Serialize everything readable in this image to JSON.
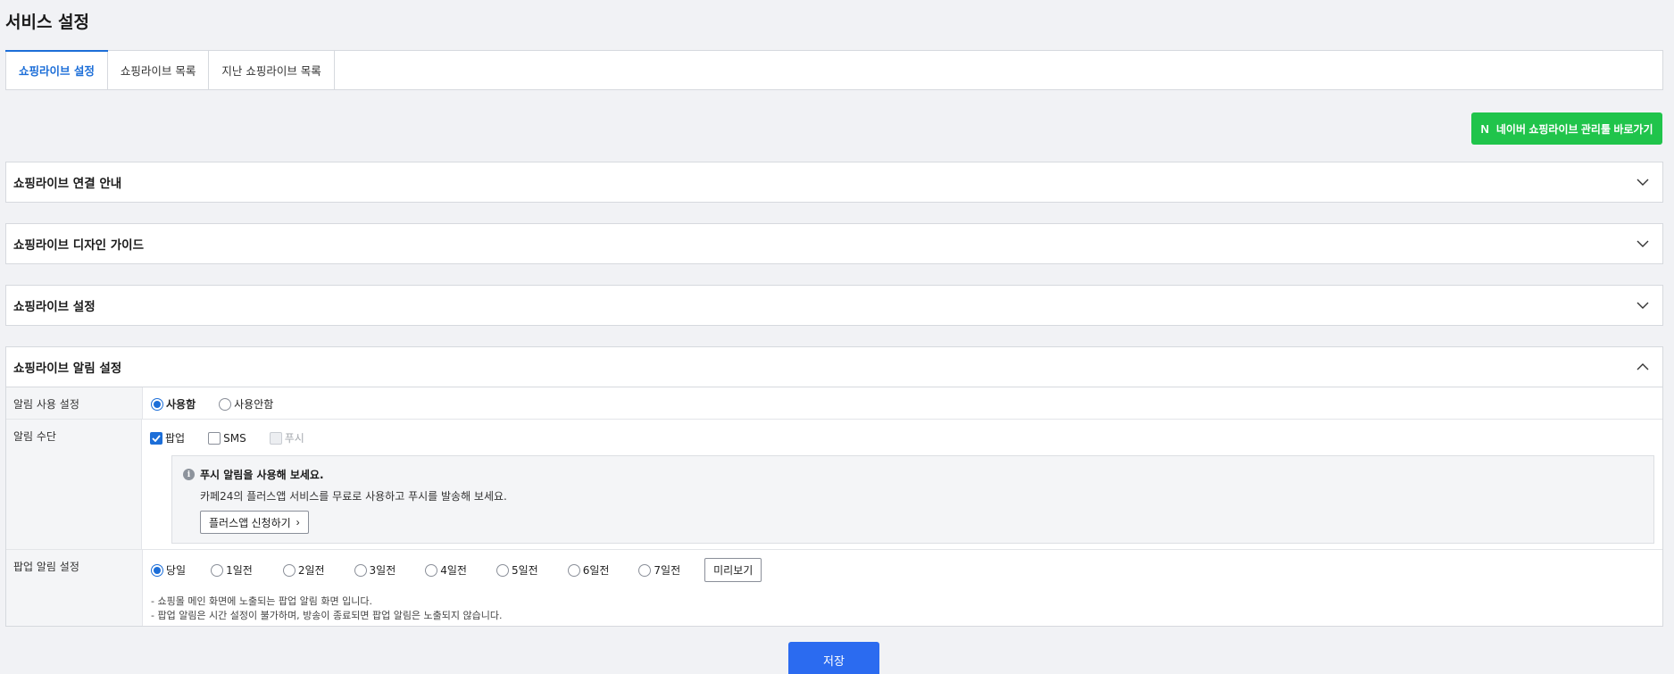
{
  "page_title": "서비스 설정",
  "tabs": [
    {
      "label": "쇼핑라이브 설정",
      "active": true
    },
    {
      "label": "쇼핑라이브 목록",
      "active": false
    },
    {
      "label": "지난 쇼핑라이브 목록",
      "active": false
    }
  ],
  "naver_button": {
    "logo": "N",
    "label": "네이버 쇼핑라이브 관리툴 바로가기",
    "color": "#20c44b"
  },
  "accordions": [
    {
      "title": "쇼핑라이브 연결 안내",
      "expanded": false
    },
    {
      "title": "쇼핑라이브 디자인 가이드",
      "expanded": false
    },
    {
      "title": "쇼핑라이브 설정",
      "expanded": false
    },
    {
      "title": "쇼핑라이브 알림 설정",
      "expanded": true
    }
  ],
  "notification": {
    "usage": {
      "label": "알림 사용 설정",
      "options": [
        {
          "label": "사용함",
          "selected": true
        },
        {
          "label": "사용안함",
          "selected": false
        }
      ]
    },
    "method": {
      "label": "알림 수단",
      "options": [
        {
          "label": "팝업",
          "checked": true,
          "disabled": false
        },
        {
          "label": "SMS",
          "checked": false,
          "disabled": false
        },
        {
          "label": "푸시",
          "checked": false,
          "disabled": true
        }
      ],
      "info": {
        "icon": "info-icon",
        "title": "푸시 알림을 사용해 보세요.",
        "desc": "카페24의 플러스앱 서비스를 무료로 사용하고 푸시를 발송해 보세요.",
        "button": "플러스앱 신청하기",
        "button_icon": "›"
      }
    },
    "popup": {
      "label": "팝업 알림 설정",
      "options": [
        {
          "label": "당일",
          "selected": true
        },
        {
          "label": "1일전",
          "selected": false
        },
        {
          "label": "2일전",
          "selected": false
        },
        {
          "label": "3일전",
          "selected": false
        },
        {
          "label": "4일전",
          "selected": false
        },
        {
          "label": "5일전",
          "selected": false
        },
        {
          "label": "6일전",
          "selected": false
        },
        {
          "label": "7일전",
          "selected": false
        }
      ],
      "preview_button": "미리보기",
      "notes": [
        "- 쇼핑몰 메인 화면에 노출되는 팝업 알림 화면 입니다.",
        "- 팝업 알림은 시간 설정이 불가하며, 방송이 종료되면 팝업 알림은 노출되지 않습니다."
      ]
    }
  },
  "save_button": "저장",
  "colors": {
    "accent": "#1c6ed8",
    "save": "#2b6bf0",
    "naver": "#20c44b"
  }
}
